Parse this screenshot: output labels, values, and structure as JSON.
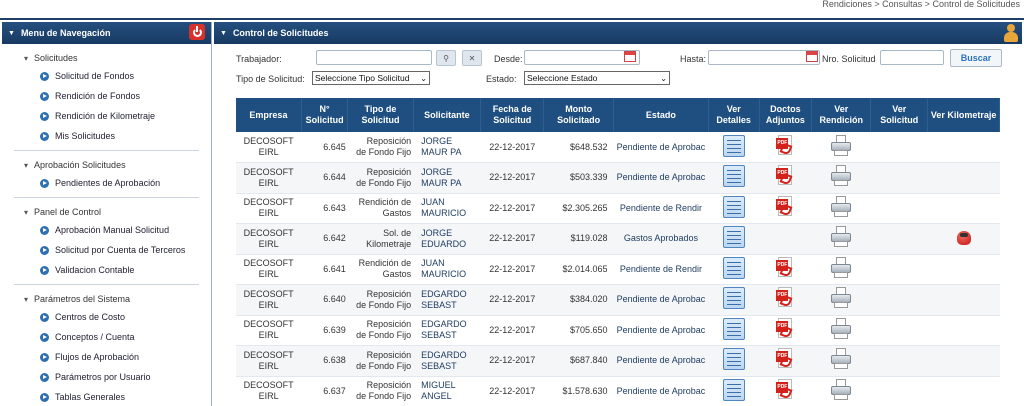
{
  "breadcrumb": "Rendiciones > Consultas > Control de Solicitudes",
  "sidebar": {
    "title": "Menu de Navegación",
    "groups": [
      {
        "title": "Solicitudes",
        "items": [
          "Solicitud de Fondos",
          "Rendición de Fondos",
          "Rendición de Kilometraje",
          "Mis Solicitudes"
        ]
      },
      {
        "title": "Aprobación Solicitudes",
        "items": [
          "Pendientes de Aprobación"
        ]
      },
      {
        "title": "Panel de Control",
        "items": [
          "Aprobación Manual Solicitud",
          "Solicitud por Cuenta de Terceros",
          "Validacion Contable"
        ]
      },
      {
        "title": "Parámetros del Sistema",
        "items": [
          "Centros de Costo",
          "Conceptos / Cuenta",
          "Flujos de Aprobación",
          "Parámetros por Usuario",
          "Tablas Generales"
        ]
      }
    ]
  },
  "main": {
    "title": "Control de Solicitudes",
    "filters": {
      "trabajador_label": "Trabajador:",
      "desde_label": "Desde:",
      "hasta_label": "Hasta:",
      "nro_label": "Nro. Solicitud",
      "buscar_label": "Buscar",
      "tipo_label": "Tipo de Solicitud:",
      "tipo_value": "Seleccione Tipo Solicitud",
      "estado_label": "Estado:",
      "estado_value": "Seleccione Estado"
    },
    "columns": [
      "Empresa",
      "N° Solicitud",
      "Tipo de Solicitud",
      "Solicitante",
      "Fecha de Solicitud",
      "Monto Solicitado",
      "Estado",
      "Ver Detalles",
      "Doctos Adjuntos",
      "Ver Rendición",
      "Ver Solicitud",
      "Ver Kilometraje"
    ],
    "rows": [
      {
        "empresa": [
          "DECOSOFT",
          "EIRL"
        ],
        "num": "6.645",
        "tipo": [
          "Reposición",
          "de Fondo Fijo"
        ],
        "solicitante": [
          "JORGE",
          "MAUR PA"
        ],
        "fecha": "22-12-2017",
        "monto": "$648.532",
        "estado": "Pendiente de Aprobac",
        "pdf": true,
        "km": false
      },
      {
        "empresa": [
          "DECOSOFT",
          "EIRL"
        ],
        "num": "6.644",
        "tipo": [
          "Reposición",
          "de Fondo Fijo"
        ],
        "solicitante": [
          "JORGE",
          "MAUR PA"
        ],
        "fecha": "22-12-2017",
        "monto": "$503.339",
        "estado": "Pendiente de Aprobac",
        "pdf": true,
        "km": false
      },
      {
        "empresa": [
          "DECOSOFT",
          "EIRL"
        ],
        "num": "6.643",
        "tipo": [
          "Rendición de",
          "Gastos"
        ],
        "solicitante": [
          "JUAN",
          "MAURICIO"
        ],
        "fecha": "22-12-2017",
        "monto": "$2.305.265",
        "estado": "Pendiente de Rendir",
        "pdf": true,
        "km": false
      },
      {
        "empresa": [
          "DECOSOFT",
          "EIRL"
        ],
        "num": "6.642",
        "tipo": [
          "Sol. de",
          "Kilometraje"
        ],
        "solicitante": [
          "JORGE",
          "EDUARDO"
        ],
        "fecha": "22-12-2017",
        "monto": "$119.028",
        "estado": "Gastos Aprobados",
        "pdf": false,
        "km": true
      },
      {
        "empresa": [
          "DECOSOFT",
          "EIRL"
        ],
        "num": "6.641",
        "tipo": [
          "Rendición de",
          "Gastos"
        ],
        "solicitante": [
          "JUAN",
          "MAURICIO"
        ],
        "fecha": "22-12-2017",
        "monto": "$2.014.065",
        "estado": "Pendiente de Rendir",
        "pdf": true,
        "km": false
      },
      {
        "empresa": [
          "DECOSOFT",
          "EIRL"
        ],
        "num": "6.640",
        "tipo": [
          "Reposición",
          "de Fondo Fijo"
        ],
        "solicitante": [
          "EDGARDO",
          "SEBAST"
        ],
        "fecha": "22-12-2017",
        "monto": "$384.020",
        "estado": "Pendiente de Aprobac",
        "pdf": true,
        "km": false
      },
      {
        "empresa": [
          "DECOSOFT",
          "EIRL"
        ],
        "num": "6.639",
        "tipo": [
          "Reposición",
          "de Fondo Fijo"
        ],
        "solicitante": [
          "EDGARDO",
          "SEBAST"
        ],
        "fecha": "22-12-2017",
        "monto": "$705.650",
        "estado": "Pendiente de Aprobac",
        "pdf": true,
        "km": false
      },
      {
        "empresa": [
          "DECOSOFT",
          "EIRL"
        ],
        "num": "6.638",
        "tipo": [
          "Reposición",
          "de Fondo Fijo"
        ],
        "solicitante": [
          "EDGARDO",
          "SEBAST"
        ],
        "fecha": "22-12-2017",
        "monto": "$687.840",
        "estado": "Pendiente de Aprobac",
        "pdf": true,
        "km": false
      },
      {
        "empresa": [
          "DECOSOFT",
          "EIRL"
        ],
        "num": "6.637",
        "tipo": [
          "Reposición",
          "de Fondo Fijo"
        ],
        "solicitante": [
          "MIGUEL",
          "ANGEL"
        ],
        "fecha": "22-12-2017",
        "monto": "$1.578.630",
        "estado": "Pendiente de Aprobac",
        "pdf": true,
        "km": false
      }
    ]
  },
  "icons": {
    "power": "power-icon",
    "user": "user-icon",
    "details": "details-icon",
    "pdf": "pdf-icon",
    "print": "printer-icon",
    "car": "car-icon"
  },
  "colors": {
    "header_bg": "#1e4f80",
    "accent": "#2c72c0",
    "power_red": "#d9302c"
  }
}
